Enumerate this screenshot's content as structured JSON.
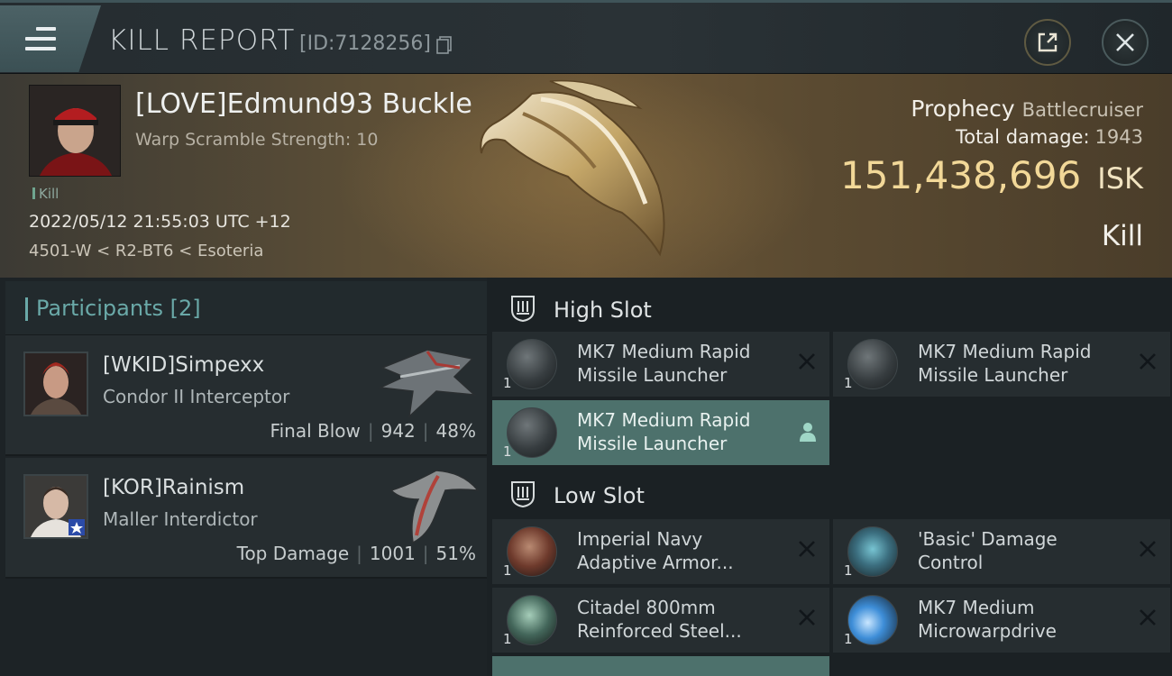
{
  "header": {
    "title": "KILL REPORT",
    "report_id": "[ID:7128256]",
    "icons": {
      "menu": "hamburger-menu-icon",
      "copy": "copy-icon",
      "share": "share-external-icon",
      "close": "close-icon"
    }
  },
  "victim": {
    "pilot": "[LOVE]Edmund93 Buckle",
    "warp_scramble": "Warp Scramble Strength: 10",
    "tag": "Kill",
    "datetime": "2022/05/12 21:55:03 UTC +12",
    "location": "4501-W < R2-BT6 < Esoteria",
    "ship_name": "Prophecy",
    "ship_class": "Battlecruiser",
    "total_damage_label": "Total damage:",
    "total_damage": "1943",
    "isk_value": "151,438,696",
    "isk_unit": "ISK",
    "result": "Kill"
  },
  "participants": {
    "label": "Participants",
    "count": "[2]",
    "items": [
      {
        "name": "[WKID]Simpexx",
        "ship": "Condor II Interceptor",
        "role": "Final Blow",
        "damage": "942",
        "percent": "48%"
      },
      {
        "name": "[KOR]Rainism",
        "ship": "Maller Interdictor",
        "role": "Top Damage",
        "damage": "1001",
        "percent": "51%"
      }
    ]
  },
  "fitting": {
    "high_slot_label": "High Slot",
    "low_slot_label": "Low Slot",
    "high": [
      {
        "name_line1": "MK7 Medium Rapid",
        "name_line2": "Missile Launcher",
        "qty": "1",
        "state": "destroyed"
      },
      {
        "name_line1": "MK7 Medium Rapid",
        "name_line2": "Missile Launcher",
        "qty": "1",
        "state": "destroyed"
      },
      {
        "name_line1": "MK7 Medium Rapid",
        "name_line2": "Missile Launcher",
        "qty": "1",
        "state": "dropped"
      }
    ],
    "low": [
      {
        "name_line1": "Imperial Navy",
        "name_line2": "Adaptive Armor...",
        "qty": "1",
        "state": "destroyed"
      },
      {
        "name_line1": "'Basic' Damage",
        "name_line2": "Control",
        "qty": "1",
        "state": "destroyed"
      },
      {
        "name_line1": "Citadel 800mm",
        "name_line2": "Reinforced Steel...",
        "qty": "1",
        "state": "destroyed"
      },
      {
        "name_line1": "MK7 Medium",
        "name_line2": "Microwarpdrive",
        "qty": "1",
        "state": "destroyed"
      }
    ]
  },
  "colors": {
    "accent": "#6aa9a8",
    "isk": "#f2d898",
    "highlight": "#4d716c"
  }
}
